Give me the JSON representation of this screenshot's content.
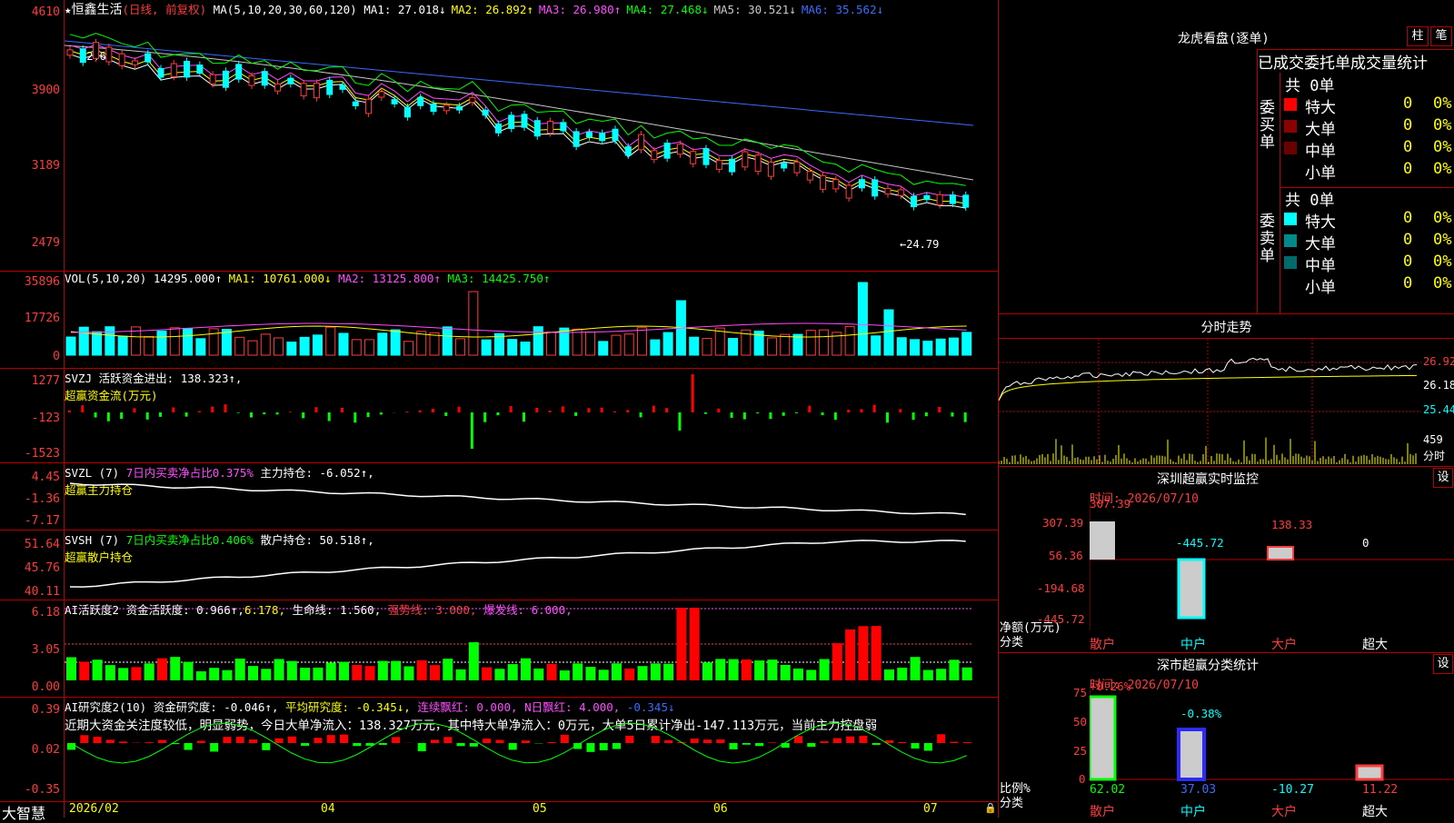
{
  "stock": {
    "name": "恒鑫生活",
    "period": "(日线, 前复权)",
    "ma_label": "MA(5,10,20,30,60,120)",
    "mas": [
      {
        "label": "MA1: 27.018↓",
        "color": "#ffffff"
      },
      {
        "label": "MA2: 26.892↑",
        "color": "#ffff00"
      },
      {
        "label": "MA3: 26.980↑",
        "color": "#ff4dff"
      },
      {
        "label": "MA4: 27.468↓",
        "color": "#00ff00"
      },
      {
        "label": "MA5: 30.521↓",
        "color": "#c8c8c8"
      },
      {
        "label": "MA6: 35.562↓",
        "color": "#3b6bff"
      }
    ],
    "high_mark": "42.63",
    "low_mark": "←24.79"
  },
  "axes": {
    "price": [
      "4610",
      "3900",
      "3189",
      "2479"
    ],
    "vol": [
      "35896",
      "17726",
      "0"
    ],
    "svzj": [
      "1277",
      "-123",
      "-1523"
    ],
    "svzl": [
      "4.45",
      "-1.36",
      "-7.17"
    ],
    "svsh": [
      "51.64",
      "45.76",
      "40.11"
    ],
    "ai1": [
      "6.18",
      "3.05",
      "0.00"
    ],
    "ai2": [
      "0.39",
      "0.02",
      "-0.35"
    ]
  },
  "panels": {
    "vol": {
      "label": "VOL(5,10,20)",
      "value": "14295.000↑",
      "ma1": "MA1: 10761.000↓",
      "ma2": "MA2: 13125.800↑",
      "ma3": "MA3: 14425.750↑"
    },
    "svzj": {
      "label": "SVZJ",
      "text": "活跃资金进出: 138.323↑,",
      "sub": "超赢资金流(万元)"
    },
    "svzl": {
      "label": "SVZL (7)",
      "text1": "7日内买卖净占比0.375%",
      "text2": "主力持仓: -6.052↑,",
      "sub": "超赢主力持仓"
    },
    "svsh": {
      "label": "SVSH (7)",
      "text1": "7日内买卖净占比0.406%",
      "text2": "散户持仓: 50.518↑,",
      "sub": "超赢散户持仓"
    },
    "ai1": {
      "label": "AI活跃度2",
      "t1": "资金活跃度: 0.966↑,",
      "t2": "6.178,",
      "t3": "生命线: 1.560,",
      "t4": "强势线: 3.000,",
      "t5": "爆发线: 6.000,"
    },
    "ai2": {
      "label": "AI研究度2(10)",
      "t1": "资金研究度: -0.046↑,",
      "t2": "平均研究度: -0.345↓,",
      "t3": "连续飘红: 0.000,",
      "t4": "N日飘红: 4.000,",
      "t5": "-0.345↓",
      "comment": "近期大资金关注度较低，明显弱势，今日大单净流入：138.327万元，其中特大单净流入：0万元，大单5日累计净出-147.113万元，当前主力控盘弱"
    }
  },
  "dates": [
    "2026/02",
    "04",
    "05",
    "06",
    "07"
  ],
  "brand": "大智慧",
  "right": {
    "lhb_title": "龙虎看盘(逐单)",
    "btn_zhu": "柱",
    "btn_bi": "笔",
    "tabs": [
      "已成交",
      "委托单",
      "成交量统计"
    ],
    "buy_label": "委买单",
    "sell_label": "委卖单",
    "buy_total": "共 0单",
    "sell_total": "共 0单",
    "rows": [
      {
        "name": "特大",
        "v": "0",
        "p": "0%"
      },
      {
        "name": "大单",
        "v": "0",
        "p": "0%"
      },
      {
        "name": "中单",
        "v": "0",
        "p": "0%"
      },
      {
        "name": "小单",
        "v": "0",
        "p": "0%"
      }
    ],
    "buy_colors": [
      "#ff0000",
      "#8b0000",
      "#6b0000",
      "#000000"
    ],
    "sell_colors": [
      "#00ffff",
      "#008b8b",
      "#006b6b",
      "#000000"
    ],
    "fs_title": "分时走势",
    "fs_ticks": [
      "26.92",
      "26.18",
      "25.44"
    ],
    "fs_vol": "459",
    "fs_unit": "分时",
    "mon_title": "深圳超赢实时监控",
    "set": "设",
    "mon_time": "时间: 2026/07/10",
    "mon_ticks": [
      "307.39",
      "56.36",
      "-194.68",
      "-445.72"
    ],
    "mon_vals": [
      "307.39",
      "-445.72",
      "138.33",
      "0"
    ],
    "mon_side1": "净额(万元)",
    "mon_side2": "分类",
    "cats": [
      "散户",
      "中户",
      "大户",
      "超大"
    ],
    "cls_title": "深市超赢分类统计",
    "cls_time": "时间: 2026/07/10",
    "cls_ticks": [
      "75",
      "50",
      "25",
      "0"
    ],
    "cls_top": [
      "+0.26%",
      "-0.38%"
    ],
    "cls_vals": [
      "62.02",
      "37.03",
      "-10.27",
      "11.22"
    ],
    "cls_side1": "比例%",
    "cls_side2": "分类"
  }
}
